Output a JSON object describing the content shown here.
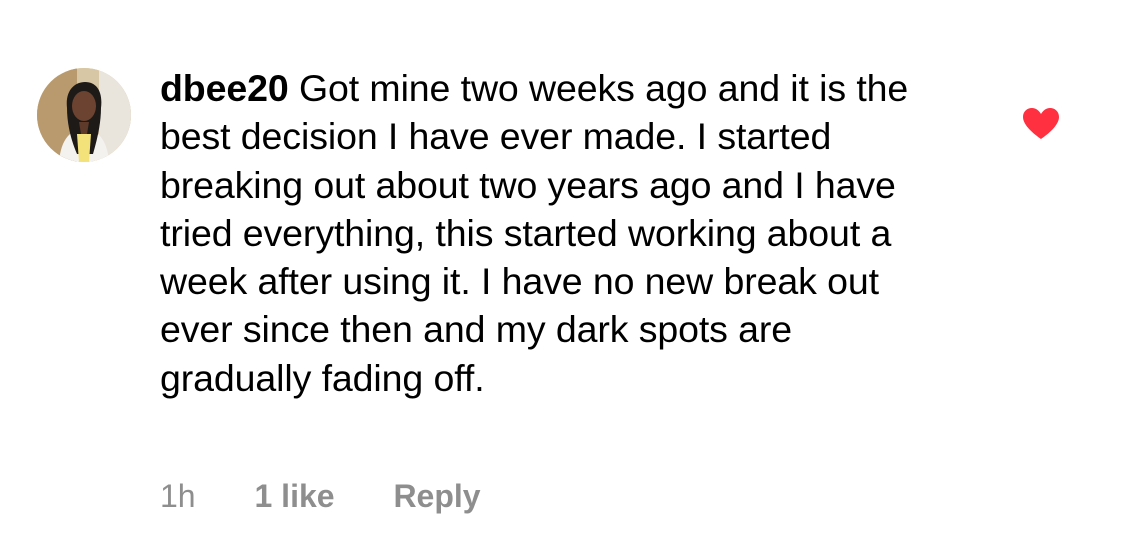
{
  "comment": {
    "username": "dbee20",
    "text": "Got mine two weeks ago and it is the best decision I have ever made. I started breaking out about two years ago and I have tried everything, this started working about a week after using it. I have no new break out ever since then and my dark spots are gradually fading off.",
    "time": "1h",
    "likes": "1 like",
    "reply_label": "Reply",
    "liked": true
  },
  "icons": {
    "like": "heart-icon"
  },
  "colors": {
    "heart": "#ff3040",
    "meta_text": "#8e8e8e",
    "text": "#000000"
  }
}
